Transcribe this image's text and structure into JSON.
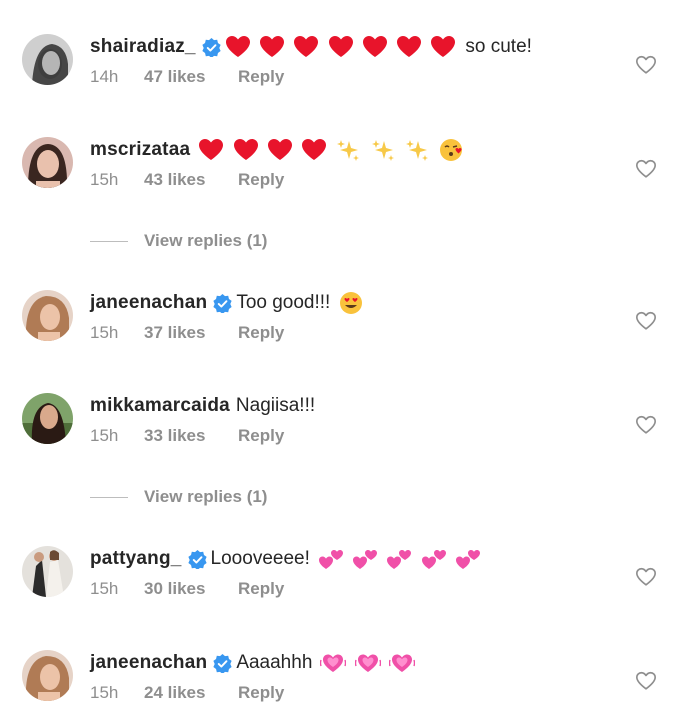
{
  "comments": [
    {
      "username": "shairadiaz_",
      "verified": true,
      "text": "so cute!",
      "emojis": [
        "red-heart",
        "red-heart",
        "red-heart",
        "red-heart",
        "red-heart",
        "red-heart",
        "red-heart"
      ],
      "emoji_position": "before",
      "time": "14h",
      "likes": "47 likes",
      "reply": "Reply"
    },
    {
      "username": "mscrizataa",
      "verified": false,
      "text": "",
      "emojis": [
        "red-heart",
        "red-heart",
        "red-heart",
        "red-heart",
        "sparkles",
        "sparkles",
        "sparkles",
        "face-blowing-kiss"
      ],
      "emoji_position": "after",
      "time": "15h",
      "likes": "43 likes",
      "reply": "Reply"
    },
    {
      "username": "janeenachan",
      "verified": true,
      "text": "Too good!!!",
      "emojis": [
        "heart-eyes"
      ],
      "emoji_position": "after",
      "time": "15h",
      "likes": "37 likes",
      "reply": "Reply"
    },
    {
      "username": "mikkamarcaida",
      "verified": false,
      "text": "Nagiisa!!!",
      "emojis": [],
      "emoji_position": "after",
      "time": "15h",
      "likes": "33 likes",
      "reply": "Reply"
    },
    {
      "username": "pattyang_",
      "verified": true,
      "text": "Loooveeee!",
      "emojis": [
        "two-hearts",
        "two-hearts",
        "two-hearts",
        "two-hearts",
        "two-hearts"
      ],
      "emoji_position": "after",
      "time": "15h",
      "likes": "30 likes",
      "reply": "Reply"
    },
    {
      "username": "janeenachan",
      "verified": true,
      "text": "Aaaahhh",
      "emojis": [
        "growing-heart",
        "growing-heart",
        "growing-heart"
      ],
      "emoji_position": "after",
      "time": "15h",
      "likes": "24 likes",
      "reply": "Reply"
    }
  ],
  "view_replies": [
    "View replies (1)",
    "View replies (1)"
  ],
  "colors": {
    "text_primary": "#262626",
    "text_secondary": "#8e8e8e",
    "verified_blue": "#3897f0",
    "like_icon": "#8e8e8e"
  },
  "icons": {
    "verified": "verified-badge-icon",
    "like": "heart-outline-icon"
  }
}
